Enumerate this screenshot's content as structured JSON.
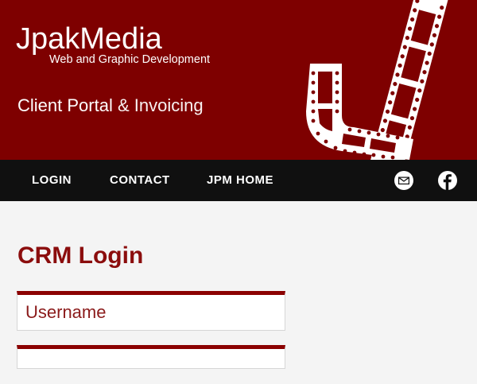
{
  "header": {
    "brand_name": "JpakMedia",
    "brand_tagline": "Web and Graphic Development",
    "portal_title_main": "Client Portal",
    "portal_title_rest": " & Invoicing",
    "colors": {
      "background": "#7e0000",
      "text": "#ffffff"
    }
  },
  "nav": {
    "items": [
      {
        "label": "LOGIN"
      },
      {
        "label": "CONTACT"
      },
      {
        "label": "JPM HOME"
      }
    ],
    "icons": [
      "mail-icon",
      "facebook-icon"
    ],
    "colors": {
      "background": "#101010",
      "text": "#ffffff"
    }
  },
  "main": {
    "title": "CRM Login",
    "username_placeholder": "Username",
    "password_placeholder": "",
    "colors": {
      "accent": "#8b0000",
      "title": "#8b0d0d"
    }
  }
}
